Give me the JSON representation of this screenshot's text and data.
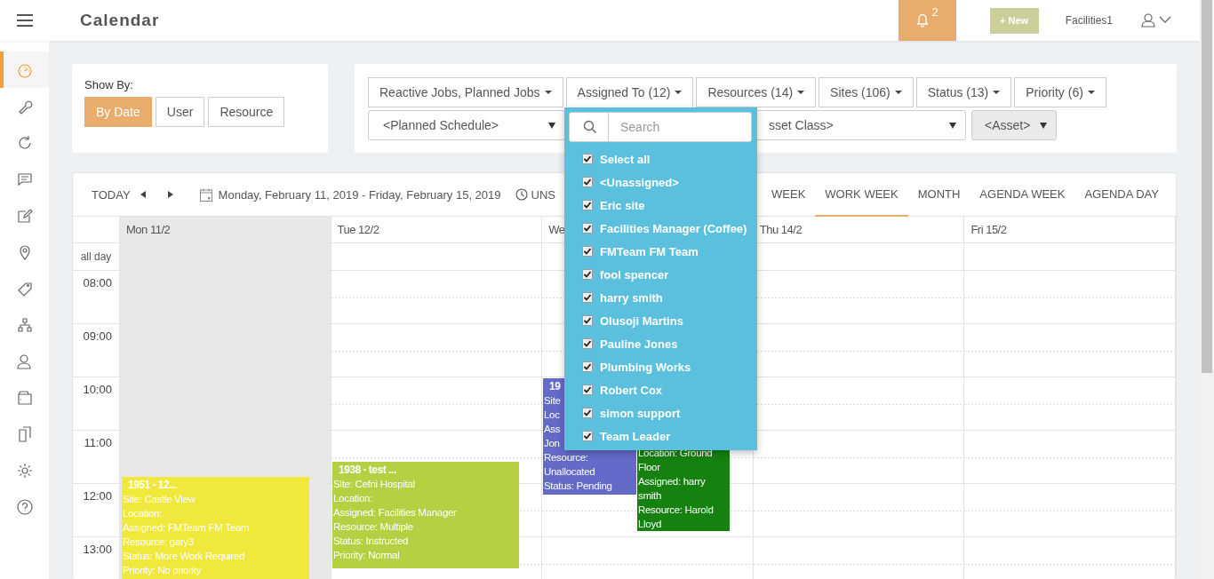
{
  "header": {
    "title": "Calendar",
    "notifications": "2",
    "new_button": "+ New",
    "user": "Facilities1"
  },
  "sidebar": {
    "items": [
      {
        "selected": true
      },
      {
        "selected": false
      },
      {
        "selected": false
      },
      {
        "selected": false
      },
      {
        "selected": false
      },
      {
        "selected": false
      },
      {
        "selected": false
      },
      {
        "selected": false
      },
      {
        "selected": false
      },
      {
        "selected": false
      },
      {
        "selected": false
      },
      {
        "selected": false
      },
      {
        "selected": false
      }
    ]
  },
  "show_by": {
    "label": "Show By:",
    "options": [
      {
        "label": "By Date",
        "selected": true
      },
      {
        "label": "User",
        "selected": false
      },
      {
        "label": "Resource",
        "selected": false
      }
    ]
  },
  "filters": {
    "dropdowns": [
      {
        "label": "Reactive Jobs, Planned Jobs",
        "open": false
      },
      {
        "label": "Assigned To (12)",
        "open": true
      },
      {
        "label": "Resources (14)",
        "open": false
      },
      {
        "label": "Sites (106)",
        "open": false
      },
      {
        "label": "Status (13)",
        "open": false
      },
      {
        "label": "Priority (6)",
        "open": false
      }
    ],
    "selects": [
      {
        "value": "<Planned Schedule>",
        "disabled": false
      },
      {
        "value": "sset Class>",
        "disabled": false
      },
      {
        "value": "<Asset>",
        "disabled": true
      }
    ]
  },
  "assigned_menu": {
    "placeholder": "Search",
    "options": [
      {
        "label": "Select all",
        "checked": true
      },
      {
        "label": "<Unassigned>",
        "checked": true
      },
      {
        "label": "Eric site",
        "checked": true
      },
      {
        "label": "Facilities Manager (Coffee)",
        "checked": true
      },
      {
        "label": "FMTeam FM Team",
        "checked": true
      },
      {
        "label": "fool spencer",
        "checked": true
      },
      {
        "label": "harry smith",
        "checked": true
      },
      {
        "label": "Olusoji Martins",
        "checked": true
      },
      {
        "label": "Pauline Jones",
        "checked": true
      },
      {
        "label": "Plumbing Works",
        "checked": true
      },
      {
        "label": "Robert Cox",
        "checked": true
      },
      {
        "label": "simon support",
        "checked": true
      },
      {
        "label": "Team Leader",
        "checked": true
      }
    ]
  },
  "calendar": {
    "toolbar": {
      "today": "TODAY",
      "range": "Monday, February 11, 2019 - Friday, February 15, 2019",
      "unscheduled": "UNS",
      "views": [
        {
          "label": "WEEK",
          "selected": false
        },
        {
          "label": "WORK WEEK",
          "selected": true
        },
        {
          "label": "MONTH",
          "selected": false
        },
        {
          "label": "AGENDA WEEK",
          "selected": false
        },
        {
          "label": "AGENDA DAY",
          "selected": false
        }
      ]
    },
    "days": [
      {
        "label": "Mon 11/2",
        "today": true
      },
      {
        "label": "Tue 12/2",
        "today": false
      },
      {
        "label": "We",
        "today": false
      },
      {
        "label": "Thu 14/2",
        "today": false
      },
      {
        "label": "Fri 15/2",
        "today": false
      }
    ],
    "all_day": "all day",
    "hours": [
      "08:00",
      "09:00",
      "10:00",
      "11:00",
      "12:00",
      "13:00"
    ],
    "events": [
      {
        "title": "1951 - 12...",
        "color": "#f0e93c",
        "lines": [
          "Site: Castle View",
          "Location:",
          "Assigned: FMTeam FM Team",
          "Resource: gary3",
          "Status: More Work Required",
          "Priority: No priority"
        ]
      },
      {
        "title": "1938 - test ...",
        "color": "#b5d043",
        "lines": [
          "Site: Cefni Hospital",
          "Location:",
          "Assigned: Facilities Manager",
          "Resource: Multiple",
          "Status: Instructed",
          "Priority: Normal"
        ]
      },
      {
        "title": "19",
        "color": "#636ac8",
        "lines": [
          "Site",
          "Loc",
          "Ass",
          "Jon",
          "Resource:",
          "Unallocated",
          "Status: Pending"
        ]
      },
      {
        "color": "#168010",
        "lines": [
          "Location: Ground Floor",
          "Assigned: harry smith",
          "Resource: Harold Lloyd"
        ]
      }
    ]
  }
}
